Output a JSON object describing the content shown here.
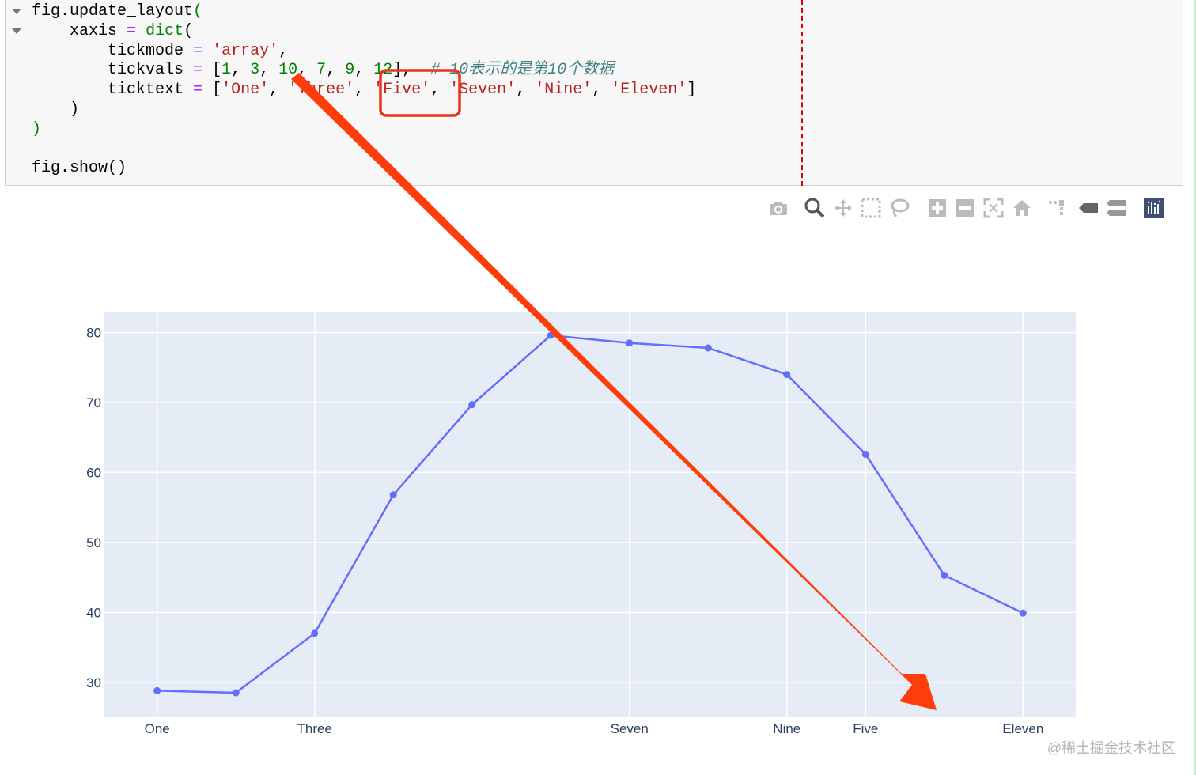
{
  "code_cell": {
    "lines": [
      "fig.update_layout(",
      "    xaxis = dict(",
      "        tickmode = 'array',",
      "        tickvals = [1, 3, 10, 7, 9, 12],  # 10表示的是第10个数据",
      "        ticktext = ['One', 'Three', 'Five', 'Seven', 'Nine', 'Eleven']",
      "    )",
      ")",
      "",
      "fig.show()"
    ]
  },
  "toolbar": {
    "icons": [
      "camera-icon",
      "zoom-icon",
      "pan-icon",
      "box-select-icon",
      "lasso-select-icon",
      "zoom-in-icon",
      "zoom-out-icon",
      "autoscale-icon",
      "reset-axes-icon",
      "spike-lines-icon",
      "hover-closest-icon",
      "hover-compare-icon",
      "plotly-logo-icon"
    ]
  },
  "annotation": {
    "highlight_color": "#e8341c",
    "arrow_color": "#ff3d0a"
  },
  "watermark": "@稀土掘金技术社区",
  "chart_data": {
    "type": "line",
    "x": [
      1,
      2,
      3,
      4,
      5,
      6,
      7,
      8,
      9,
      10,
      11,
      12
    ],
    "y": [
      28.8,
      28.5,
      37,
      56.8,
      69.7,
      79.6,
      78.5,
      77.8,
      74,
      62.6,
      45.3,
      39.9
    ],
    "xlim": [
      0.33,
      12.67
    ],
    "ylim": [
      25,
      83
    ],
    "y_ticks": [
      30,
      40,
      50,
      60,
      70,
      80
    ],
    "x_ticks": [
      {
        "value": 1,
        "label": "One"
      },
      {
        "value": 3,
        "label": "Three"
      },
      {
        "value": 7,
        "label": "Seven"
      },
      {
        "value": 9,
        "label": "Nine"
      },
      {
        "value": 10,
        "label": "Five"
      },
      {
        "value": 12,
        "label": "Eleven"
      }
    ],
    "line_color": "#636efa",
    "plot_bg": "#e5ecf6",
    "grid": true
  }
}
